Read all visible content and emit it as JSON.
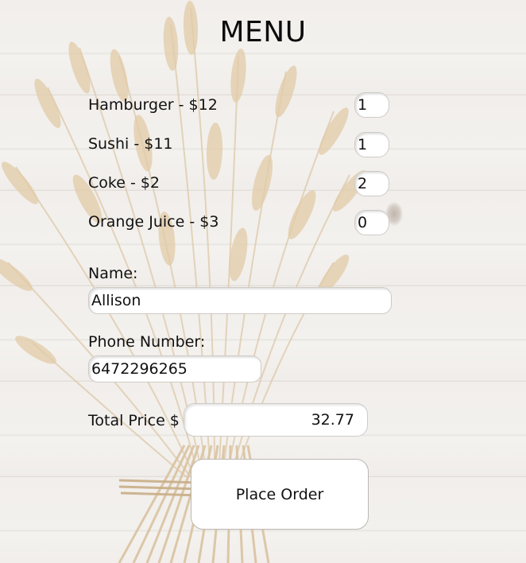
{
  "menu": {
    "title": "MENU",
    "items": [
      {
        "label": "Hamburger - $12",
        "quantity": "1"
      },
      {
        "label": "Sushi - $11",
        "quantity": "1"
      },
      {
        "label": "Coke - $2",
        "quantity": "2"
      },
      {
        "label": "Orange Juice - $3",
        "quantity": "0"
      }
    ]
  },
  "customer": {
    "name_label": "Name:",
    "name_value": "Allison",
    "phone_label": "Phone Number:",
    "phone_value": "6472296265"
  },
  "order": {
    "total_label": "Total Price $",
    "total_value": "32.77",
    "place_order_label": "Place Order"
  },
  "colors": {
    "background": "#f1eeeb",
    "field_background": "#ffffff",
    "text": "#111111",
    "wheat": "#c8ad86"
  },
  "icons": {
    "background_image": "wheat-bouquet"
  }
}
